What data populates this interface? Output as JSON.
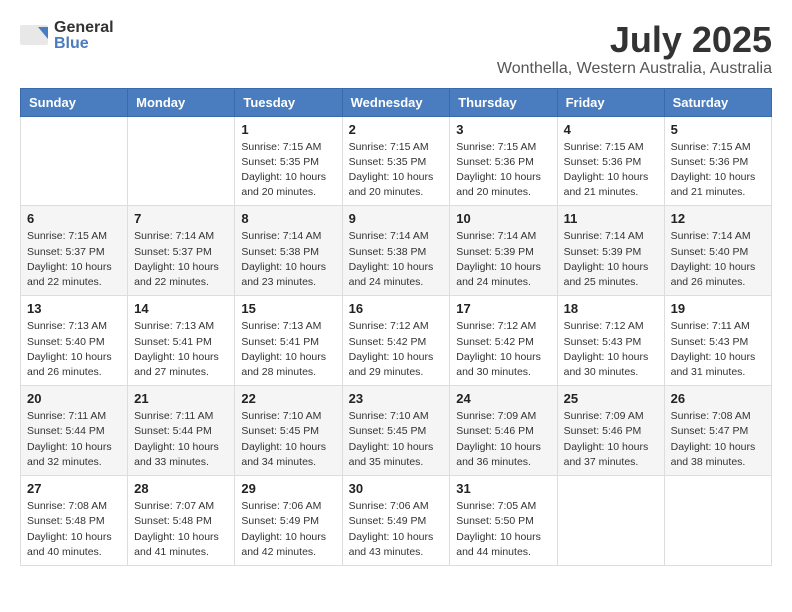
{
  "header": {
    "logo_general": "General",
    "logo_blue": "Blue",
    "month": "July 2025",
    "location": "Wonthella, Western Australia, Australia"
  },
  "weekdays": [
    "Sunday",
    "Monday",
    "Tuesday",
    "Wednesday",
    "Thursday",
    "Friday",
    "Saturday"
  ],
  "weeks": [
    [
      {
        "day": "",
        "detail": ""
      },
      {
        "day": "",
        "detail": ""
      },
      {
        "day": "1",
        "detail": "Sunrise: 7:15 AM\nSunset: 5:35 PM\nDaylight: 10 hours\nand 20 minutes."
      },
      {
        "day": "2",
        "detail": "Sunrise: 7:15 AM\nSunset: 5:35 PM\nDaylight: 10 hours\nand 20 minutes."
      },
      {
        "day": "3",
        "detail": "Sunrise: 7:15 AM\nSunset: 5:36 PM\nDaylight: 10 hours\nand 20 minutes."
      },
      {
        "day": "4",
        "detail": "Sunrise: 7:15 AM\nSunset: 5:36 PM\nDaylight: 10 hours\nand 21 minutes."
      },
      {
        "day": "5",
        "detail": "Sunrise: 7:15 AM\nSunset: 5:36 PM\nDaylight: 10 hours\nand 21 minutes."
      }
    ],
    [
      {
        "day": "6",
        "detail": "Sunrise: 7:15 AM\nSunset: 5:37 PM\nDaylight: 10 hours\nand 22 minutes."
      },
      {
        "day": "7",
        "detail": "Sunrise: 7:14 AM\nSunset: 5:37 PM\nDaylight: 10 hours\nand 22 minutes."
      },
      {
        "day": "8",
        "detail": "Sunrise: 7:14 AM\nSunset: 5:38 PM\nDaylight: 10 hours\nand 23 minutes."
      },
      {
        "day": "9",
        "detail": "Sunrise: 7:14 AM\nSunset: 5:38 PM\nDaylight: 10 hours\nand 24 minutes."
      },
      {
        "day": "10",
        "detail": "Sunrise: 7:14 AM\nSunset: 5:39 PM\nDaylight: 10 hours\nand 24 minutes."
      },
      {
        "day": "11",
        "detail": "Sunrise: 7:14 AM\nSunset: 5:39 PM\nDaylight: 10 hours\nand 25 minutes."
      },
      {
        "day": "12",
        "detail": "Sunrise: 7:14 AM\nSunset: 5:40 PM\nDaylight: 10 hours\nand 26 minutes."
      }
    ],
    [
      {
        "day": "13",
        "detail": "Sunrise: 7:13 AM\nSunset: 5:40 PM\nDaylight: 10 hours\nand 26 minutes."
      },
      {
        "day": "14",
        "detail": "Sunrise: 7:13 AM\nSunset: 5:41 PM\nDaylight: 10 hours\nand 27 minutes."
      },
      {
        "day": "15",
        "detail": "Sunrise: 7:13 AM\nSunset: 5:41 PM\nDaylight: 10 hours\nand 28 minutes."
      },
      {
        "day": "16",
        "detail": "Sunrise: 7:12 AM\nSunset: 5:42 PM\nDaylight: 10 hours\nand 29 minutes."
      },
      {
        "day": "17",
        "detail": "Sunrise: 7:12 AM\nSunset: 5:42 PM\nDaylight: 10 hours\nand 30 minutes."
      },
      {
        "day": "18",
        "detail": "Sunrise: 7:12 AM\nSunset: 5:43 PM\nDaylight: 10 hours\nand 30 minutes."
      },
      {
        "day": "19",
        "detail": "Sunrise: 7:11 AM\nSunset: 5:43 PM\nDaylight: 10 hours\nand 31 minutes."
      }
    ],
    [
      {
        "day": "20",
        "detail": "Sunrise: 7:11 AM\nSunset: 5:44 PM\nDaylight: 10 hours\nand 32 minutes."
      },
      {
        "day": "21",
        "detail": "Sunrise: 7:11 AM\nSunset: 5:44 PM\nDaylight: 10 hours\nand 33 minutes."
      },
      {
        "day": "22",
        "detail": "Sunrise: 7:10 AM\nSunset: 5:45 PM\nDaylight: 10 hours\nand 34 minutes."
      },
      {
        "day": "23",
        "detail": "Sunrise: 7:10 AM\nSunset: 5:45 PM\nDaylight: 10 hours\nand 35 minutes."
      },
      {
        "day": "24",
        "detail": "Sunrise: 7:09 AM\nSunset: 5:46 PM\nDaylight: 10 hours\nand 36 minutes."
      },
      {
        "day": "25",
        "detail": "Sunrise: 7:09 AM\nSunset: 5:46 PM\nDaylight: 10 hours\nand 37 minutes."
      },
      {
        "day": "26",
        "detail": "Sunrise: 7:08 AM\nSunset: 5:47 PM\nDaylight: 10 hours\nand 38 minutes."
      }
    ],
    [
      {
        "day": "27",
        "detail": "Sunrise: 7:08 AM\nSunset: 5:48 PM\nDaylight: 10 hours\nand 40 minutes."
      },
      {
        "day": "28",
        "detail": "Sunrise: 7:07 AM\nSunset: 5:48 PM\nDaylight: 10 hours\nand 41 minutes."
      },
      {
        "day": "29",
        "detail": "Sunrise: 7:06 AM\nSunset: 5:49 PM\nDaylight: 10 hours\nand 42 minutes."
      },
      {
        "day": "30",
        "detail": "Sunrise: 7:06 AM\nSunset: 5:49 PM\nDaylight: 10 hours\nand 43 minutes."
      },
      {
        "day": "31",
        "detail": "Sunrise: 7:05 AM\nSunset: 5:50 PM\nDaylight: 10 hours\nand 44 minutes."
      },
      {
        "day": "",
        "detail": ""
      },
      {
        "day": "",
        "detail": ""
      }
    ]
  ]
}
